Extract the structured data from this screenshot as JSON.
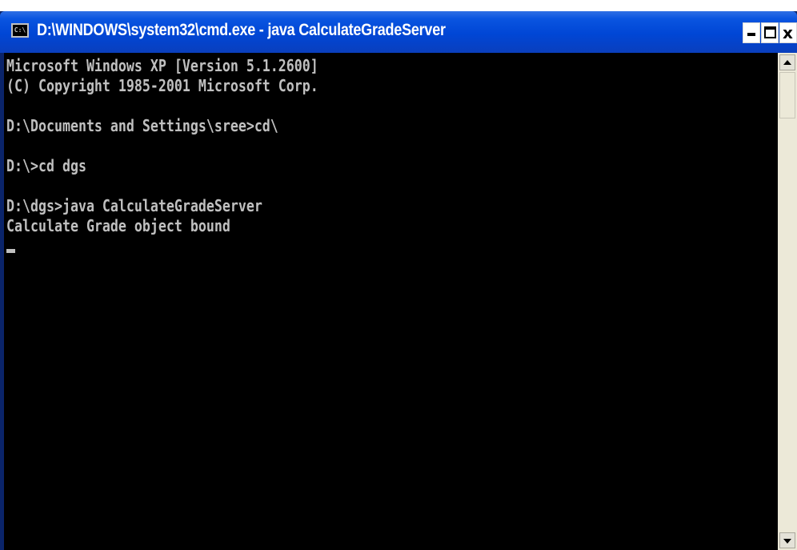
{
  "window": {
    "title": "D:\\WINDOWS\\system32\\cmd.exe - java CalculateGradeServer",
    "icon_label": "C:\\",
    "minimize_symbol": "-",
    "maximize_symbol": "□",
    "close_symbol": "x"
  },
  "console": {
    "lines": [
      "Microsoft Windows XP [Version 5.1.2600]",
      "(C) Copyright 1985-2001 Microsoft Corp.",
      "",
      "D:\\Documents and Settings\\sree>cd\\",
      "",
      "D:\\>cd dgs",
      "",
      "D:\\dgs>java CalculateGradeServer",
      "Calculate Grade object bound"
    ]
  },
  "icons": {
    "app": "cmd-prompt-icon",
    "minimize": "minimize-icon",
    "maximize": "maximize-icon",
    "close": "close-icon",
    "scroll_up": "arrow-up-icon",
    "scroll_down": "arrow-down-icon"
  },
  "colors": {
    "titlebar": "#0046d5",
    "console_bg": "#000000",
    "console_fg": "#c0c0c0",
    "scrollbar": "#ece9d8"
  }
}
